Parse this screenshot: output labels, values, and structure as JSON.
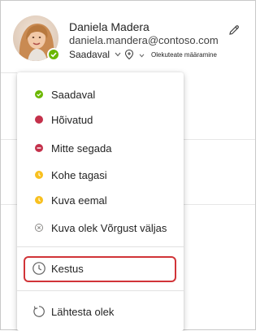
{
  "user": {
    "name": "Daniela Madera",
    "email": "daniela.mandera@contoso.com",
    "status_label": "Saadaval",
    "status_message_label": "Olekuteate määramine"
  },
  "colors": {
    "available": "#6bb700",
    "busy": "#c4314b",
    "away": "#f8c01f",
    "offline": "#8a8886",
    "highlight": "#d13438"
  },
  "icons": {
    "available": "check-circle-icon",
    "busy": "busy-dot-icon",
    "dnd": "minus-circle-icon",
    "brb": "clock-dot-icon",
    "away": "clock-dot-icon",
    "offline": "x-circle-icon",
    "duration": "clock-icon",
    "reset": "reset-icon",
    "location": "location-icon",
    "edit": "pencil-icon"
  },
  "menu": {
    "items": [
      {
        "label": "Saadaval"
      },
      {
        "label": "Hõivatud"
      },
      {
        "label": "Mitte segada"
      },
      {
        "label": "Kohe tagasi"
      },
      {
        "label": "Kuva eemal"
      },
      {
        "label": "Kuva olek Võrgust väljas"
      }
    ],
    "duration_label": "Kestus",
    "reset_label": "Lähtesta olek"
  }
}
